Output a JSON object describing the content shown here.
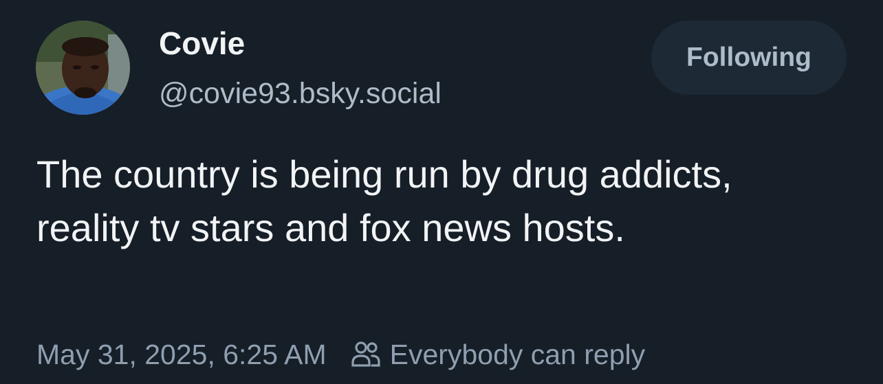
{
  "post": {
    "author": {
      "display_name": "Covie",
      "handle": "@covie93.bsky.social",
      "avatar_icon": "user-avatar"
    },
    "follow_button": {
      "label": "Following"
    },
    "text": "The country is being run by drug addicts, reality tv stars and fox news hosts.",
    "timestamp": "May 31, 2025, 6:25 AM",
    "reply_setting": {
      "icon": "people-icon",
      "label": "Everybody can reply"
    }
  },
  "colors": {
    "background": "#161e27",
    "primary_text": "#f1f3f5",
    "secondary_text": "#aebbc9",
    "meta_text": "#8f9fb0",
    "button_bg": "#1e2936"
  }
}
